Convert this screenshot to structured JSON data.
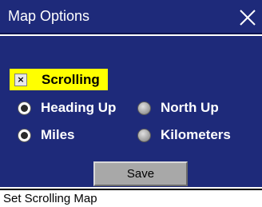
{
  "window": {
    "title": "Map Options"
  },
  "options": {
    "scrolling": {
      "label": "Scrolling",
      "checked": true,
      "mark": "×"
    },
    "orientation": [
      {
        "label": "Heading Up",
        "selected": true
      },
      {
        "label": "North Up",
        "selected": false
      }
    ],
    "units": [
      {
        "label": "Miles",
        "selected": true
      },
      {
        "label": "Kilometers",
        "selected": false
      }
    ]
  },
  "actions": {
    "save_label": "Save"
  },
  "status": {
    "text": "Set Scrolling Map"
  },
  "icons": {
    "close": "close-icon",
    "checkbox": "checkbox-icon",
    "radio": "radio-icon"
  },
  "colors": {
    "panel": "#1e2a7a",
    "highlight": "#ffff00",
    "button": "#a8a8a8"
  }
}
